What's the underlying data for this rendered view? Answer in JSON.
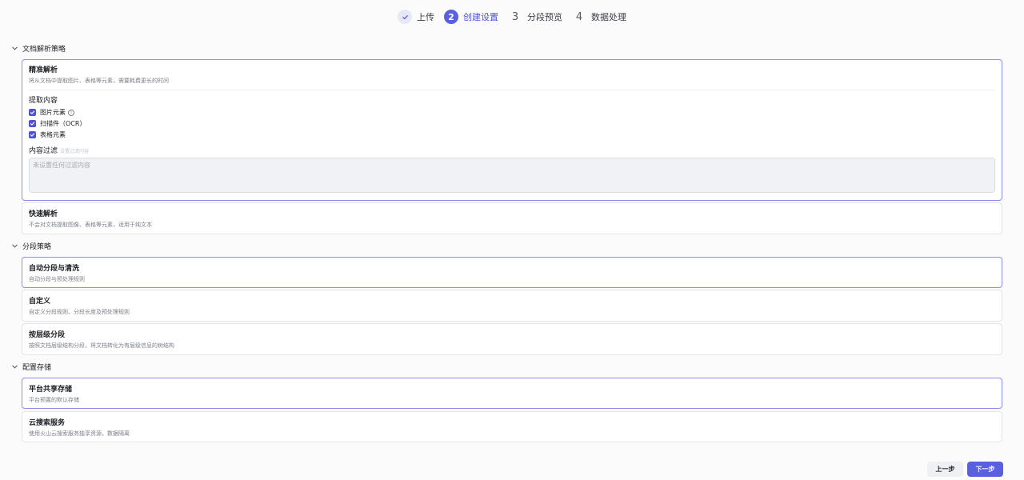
{
  "stepper": {
    "steps": [
      {
        "num": "",
        "label": "上传",
        "state": "done"
      },
      {
        "num": "2",
        "label": "创建设置",
        "state": "active"
      },
      {
        "num": "3",
        "label": "分段预览",
        "state": "pending"
      },
      {
        "num": "4",
        "label": "数据处理",
        "state": "pending"
      }
    ]
  },
  "parse": {
    "title": "文档解析策略",
    "precise": {
      "title": "精准解析",
      "desc": "将从文档中提取图片、表格等元素，需要耗费更长的时间",
      "extract_title": "提取内容",
      "options": [
        "图片元素",
        "扫描件（OCR）",
        "表格元素"
      ],
      "filter_title": "内容过滤",
      "filter_hint": "设置过滤内容",
      "filter_placeholder": "未设置任何过滤内容"
    },
    "fast": {
      "title": "快速解析",
      "desc": "不会对文档提取图像、表格等元素，适用于纯文本"
    }
  },
  "segment": {
    "title": "分段策略",
    "options": [
      {
        "title": "自动分段与清洗",
        "desc": "自动分段与预处理规则"
      },
      {
        "title": "自定义",
        "desc": "自定义分段规则、分段长度及预处理规则"
      },
      {
        "title": "按层级分段",
        "desc": "按照文档层级结构分段，将文档转化为有层级信息的树结构"
      }
    ]
  },
  "storage": {
    "title": "配置存储",
    "options": [
      {
        "title": "平台共享存储",
        "desc": "平台预置的默认存储"
      },
      {
        "title": "云搜索服务",
        "desc": "使用火山云搜索服务独享资源，数据隔离"
      }
    ]
  },
  "footer": {
    "prev_label": "上一步",
    "next_label": "下一步"
  },
  "colors": {
    "accent": "#5a5fe0",
    "selected_border": "#8b8ef0"
  }
}
